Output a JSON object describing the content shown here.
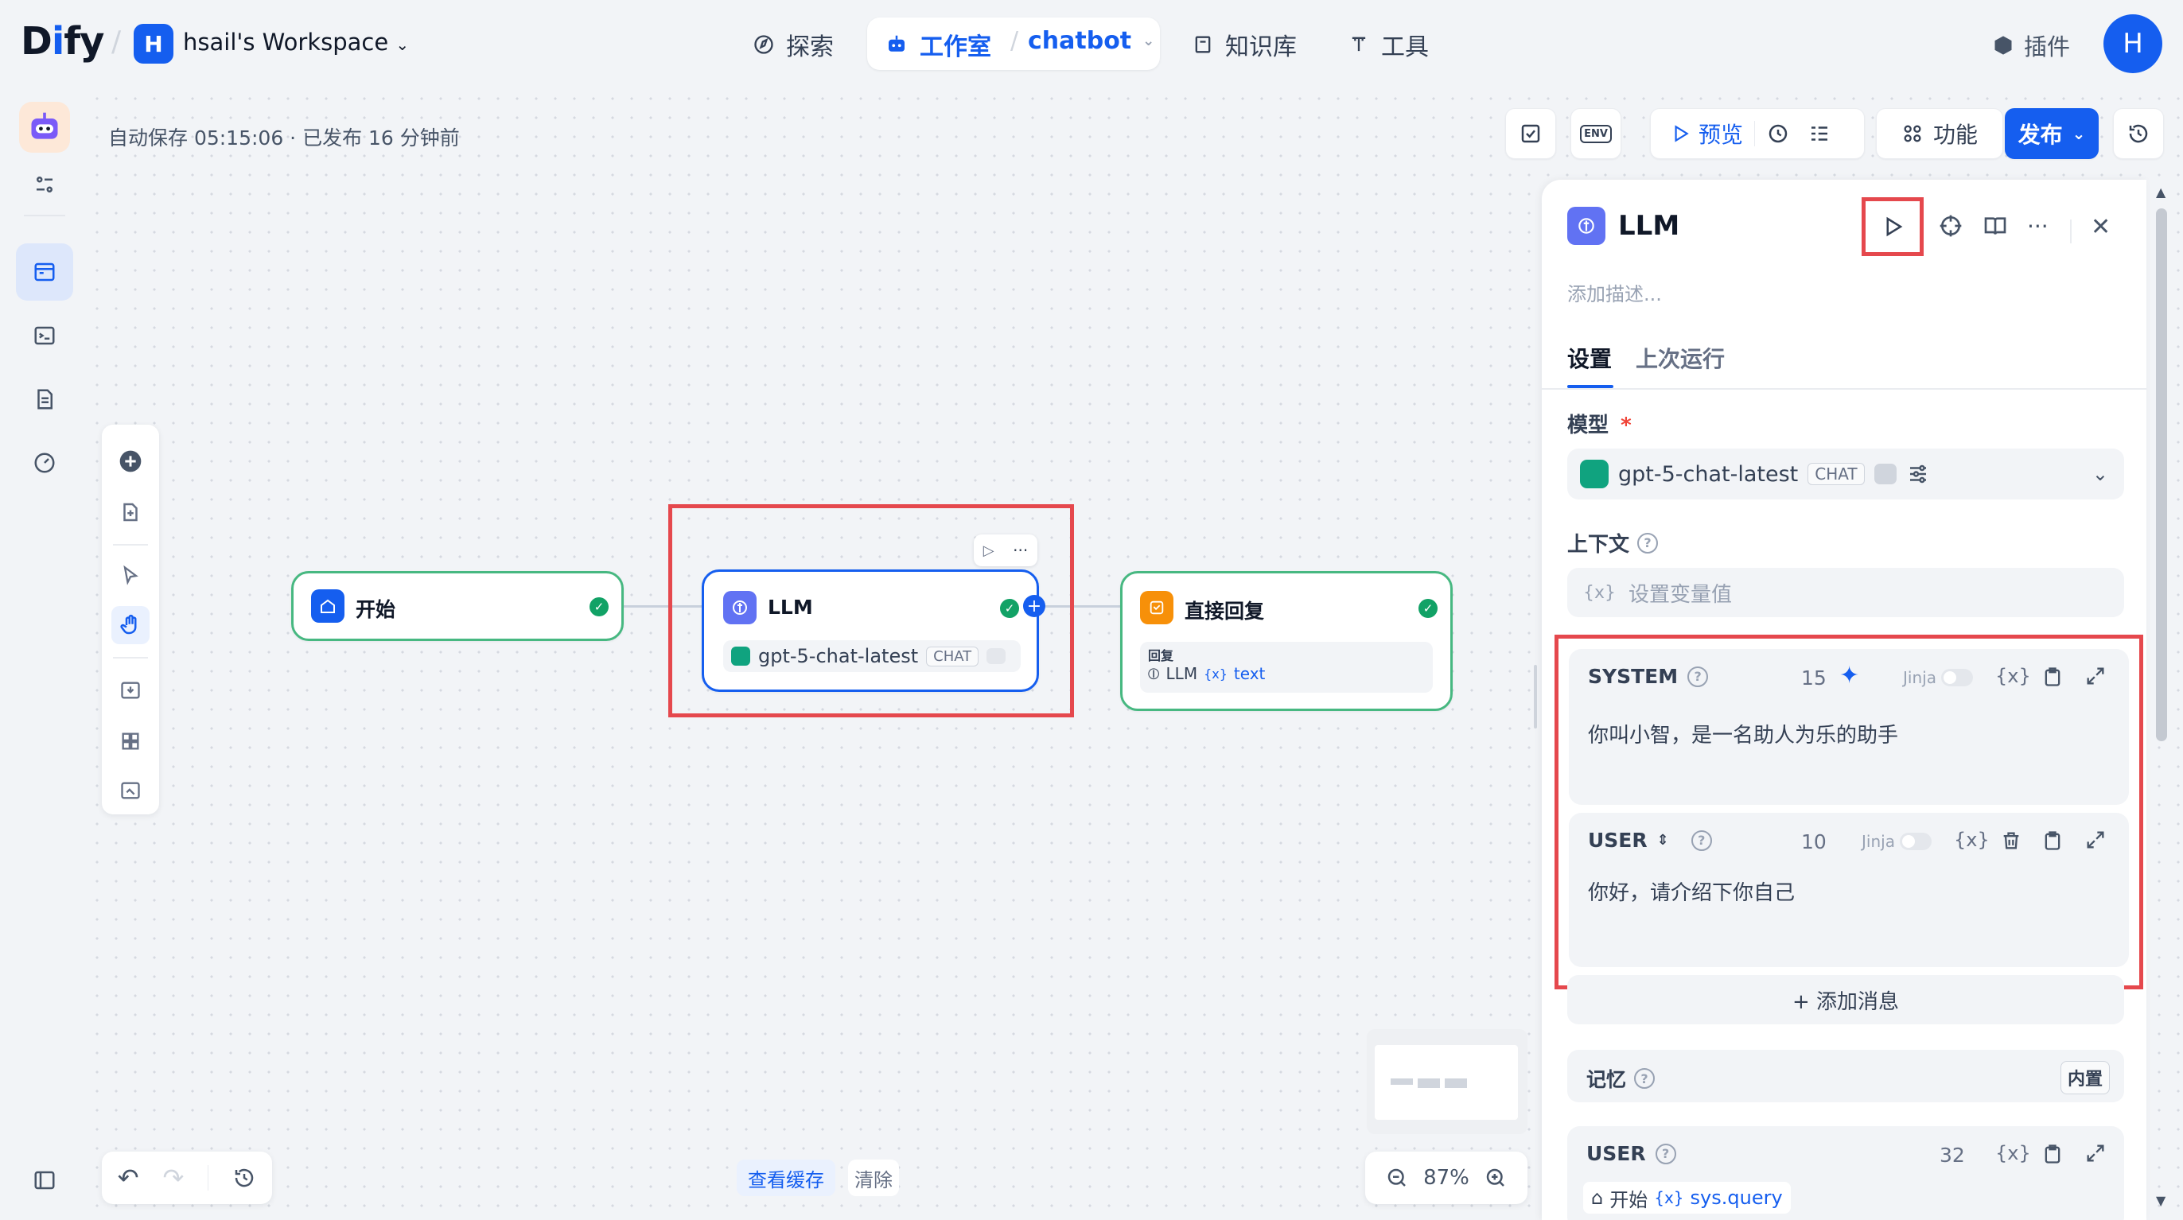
{
  "header": {
    "logo": "Dify",
    "workspace_initial": "H",
    "workspace_name": "hsail's Workspace",
    "nav": {
      "explore": "探索",
      "studio": "工作室",
      "app": "chatbot",
      "knowledge": "知识库",
      "tools": "工具"
    },
    "plugins": "插件",
    "user_initial": "H"
  },
  "canvas": {
    "autosave": "自动保存 05:15:06 · 已发布 16 分钟前",
    "toolbar": {
      "env": "ENV",
      "preview": "预览",
      "features": "功能",
      "publish": "发布"
    },
    "nodes": {
      "start": {
        "title": "开始"
      },
      "llm": {
        "title": "LLM",
        "model": "gpt-5-chat-latest",
        "mode": "CHAT"
      },
      "answer": {
        "title": "直接回复",
        "reply_label": "回复",
        "source_node": "LLM",
        "source_var": "text"
      }
    },
    "bottom": {
      "view_cache": "查看缓存",
      "clear": "清除",
      "zoom": "87%"
    }
  },
  "panel": {
    "title": "LLM",
    "desc_placeholder": "添加描述...",
    "tabs": {
      "settings": "设置",
      "last_run": "上次运行"
    },
    "model_label": "模型",
    "required_mark": "*",
    "model_name": "gpt-5-chat-latest",
    "model_mode": "CHAT",
    "context_label": "上下文",
    "context_placeholder": "设置变量值",
    "messages": [
      {
        "role": "SYSTEM",
        "count": "15",
        "jinja": "Jinja",
        "text": "你叫小智，是一名助人为乐的助手"
      },
      {
        "role": "USER",
        "count": "10",
        "jinja": "Jinja",
        "text": "你好，请介绍下你自己"
      }
    ],
    "add_message": "+ 添加消息",
    "memory_label": "记忆",
    "memory_badge": "内置",
    "memory_user": {
      "role": "USER",
      "count": "32",
      "source_node": "开始",
      "source_var": "sys.query"
    }
  }
}
